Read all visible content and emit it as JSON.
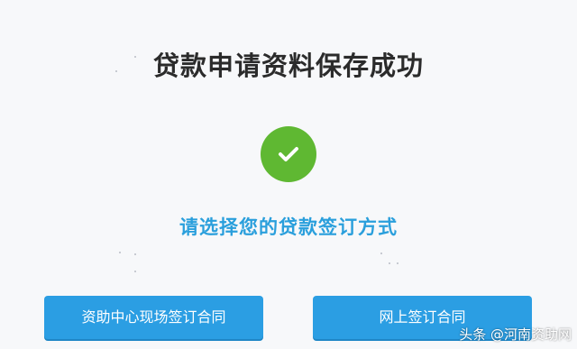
{
  "page": {
    "title": "贷款申请资料保存成功",
    "subtitle": "请选择您的贷款签订方式"
  },
  "status": {
    "icon": "checkmark-icon",
    "color": "#5fb832"
  },
  "buttons": {
    "onsite_label": "资助中心现场签订合同",
    "online_label": "网上签订合同",
    "color": "#2b9ee3"
  },
  "watermark": {
    "text": "头条 @河南资助网"
  }
}
